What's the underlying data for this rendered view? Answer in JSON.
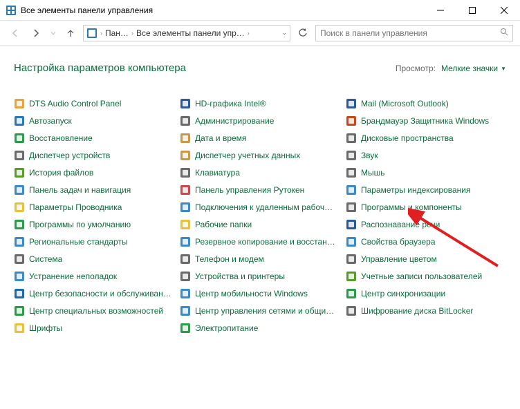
{
  "window": {
    "title": "Все элементы панели управления"
  },
  "breadcrumb": {
    "part1": "Пан…",
    "part2": "Все элементы панели упр…"
  },
  "search": {
    "placeholder": "Поиск в панели управления"
  },
  "header": {
    "title": "Настройка параметров компьютера",
    "view_label": "Просмотр:",
    "view_value": "Мелкие значки"
  },
  "items": {
    "col1": [
      {
        "label": "DTS Audio Control Panel",
        "icon_color": "#e8a33d"
      },
      {
        "label": "Автозапуск",
        "icon_color": "#2a7ab8"
      },
      {
        "label": "Восстановление",
        "icon_color": "#2a9c4a"
      },
      {
        "label": "Диспетчер устройств",
        "icon_color": "#6b6b6b"
      },
      {
        "label": "История файлов",
        "icon_color": "#5a9c2a"
      },
      {
        "label": "Панель задач и навигация",
        "icon_color": "#3a8bc8"
      },
      {
        "label": "Параметры Проводника",
        "icon_color": "#e8c23d"
      },
      {
        "label": "Программы по умолчанию",
        "icon_color": "#2a9c4a"
      },
      {
        "label": "Региональные стандарты",
        "icon_color": "#3a8bc8"
      },
      {
        "label": "Система",
        "icon_color": "#6b6b6b"
      },
      {
        "label": "Устранение неполадок",
        "icon_color": "#3a8bc8"
      },
      {
        "label": "Центр безопасности и обслуживан…",
        "icon_color": "#1a6ba8"
      },
      {
        "label": "Центр специальных возможностей",
        "icon_color": "#2a9c4a"
      },
      {
        "label": "Шрифты",
        "icon_color": "#e8c23d"
      }
    ],
    "col2": [
      {
        "label": "HD-графика Intel®",
        "icon_color": "#2a5a9c"
      },
      {
        "label": "Администрирование",
        "icon_color": "#6b6b6b"
      },
      {
        "label": "Дата и время",
        "icon_color": "#c89a4a"
      },
      {
        "label": "Диспетчер учетных данных",
        "icon_color": "#c89a4a"
      },
      {
        "label": "Клавиатура",
        "icon_color": "#6b6b6b"
      },
      {
        "label": "Панель управления Рутокен",
        "icon_color": "#c84a4a"
      },
      {
        "label": "Подключения к удаленным рабоч…",
        "icon_color": "#3a8bc8"
      },
      {
        "label": "Рабочие папки",
        "icon_color": "#e8c23d"
      },
      {
        "label": "Резервное копирование и восстан…",
        "icon_color": "#3a8bc8"
      },
      {
        "label": "Телефон и модем",
        "icon_color": "#6b6b6b"
      },
      {
        "label": "Устройства и принтеры",
        "icon_color": "#6b6b6b"
      },
      {
        "label": "Центр мобильности Windows",
        "icon_color": "#3a8bc8"
      },
      {
        "label": "Центр управления сетями и общи…",
        "icon_color": "#3a8bc8"
      },
      {
        "label": "Электропитание",
        "icon_color": "#2a9c4a"
      }
    ],
    "col3": [
      {
        "label": "Mail (Microsoft Outlook)",
        "icon_color": "#2a5a9c"
      },
      {
        "label": "Брандмауэр Защитника Windows",
        "icon_color": "#c84a1a"
      },
      {
        "label": "Дисковые пространства",
        "icon_color": "#6b6b6b"
      },
      {
        "label": "Звук",
        "icon_color": "#6b6b6b"
      },
      {
        "label": "Мышь",
        "icon_color": "#6b6b6b"
      },
      {
        "label": "Параметры индексирования",
        "icon_color": "#3a8bc8"
      },
      {
        "label": "Программы и компоненты",
        "icon_color": "#6b6b6b"
      },
      {
        "label": "Распознавание речи",
        "icon_color": "#2a5a9c"
      },
      {
        "label": "Свойства браузера",
        "icon_color": "#3a8bc8"
      },
      {
        "label": "Управление цветом",
        "icon_color": "#6b6b6b"
      },
      {
        "label": "Учетные записи пользователей",
        "icon_color": "#5a9c2a"
      },
      {
        "label": "Центр синхронизации",
        "icon_color": "#2a9c4a"
      },
      {
        "label": "Шифрование диска BitLocker",
        "icon_color": "#6b6b6b"
      }
    ]
  }
}
